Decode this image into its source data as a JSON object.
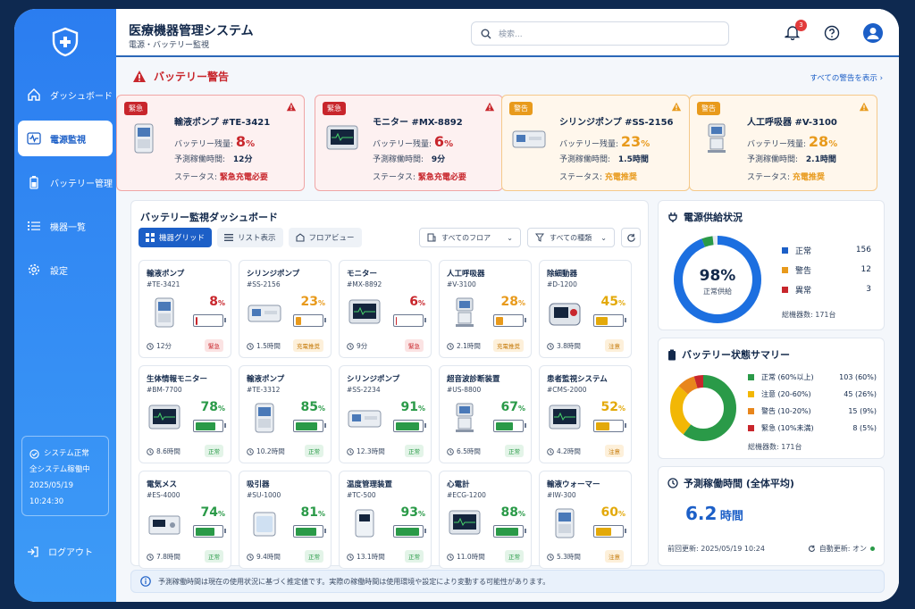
{
  "app": {
    "title": "医療機器管理システム",
    "subtitle": "電源・バッテリー監視"
  },
  "search": {
    "placeholder": "検索..."
  },
  "notifications": {
    "count": "3"
  },
  "sidebar": {
    "items": [
      {
        "label": "ダッシュボード",
        "icon": "home-icon"
      },
      {
        "label": "電源監視",
        "icon": "pulse-icon",
        "active": true
      },
      {
        "label": "バッテリー管理",
        "icon": "battery-icon"
      },
      {
        "label": "機器一覧",
        "icon": "list-icon"
      },
      {
        "label": "設定",
        "icon": "gear-icon"
      }
    ],
    "system": {
      "status": "システム正常",
      "detail": "全システム稼働中",
      "datetime": "2025/05/19 10:24:30"
    },
    "logout": "ログアウト"
  },
  "alerts": {
    "title": "バッテリー警告",
    "view_all": "すべての警告を表示",
    "labels": {
      "battery": "バッテリー残量:",
      "runtime": "予測稼働時間:",
      "status": "ステータス:"
    },
    "cards": [
      {
        "tag": "緊急",
        "name": "輸液ポンプ #TE-3421",
        "pct": "8",
        "unit": "%",
        "runtime": "12分",
        "status": "緊急充電必要",
        "level": "red"
      },
      {
        "tag": "緊急",
        "name": "モニター #MX-8892",
        "pct": "6",
        "unit": "%",
        "runtime": "9分",
        "status": "緊急充電必要",
        "level": "red"
      },
      {
        "tag": "警告",
        "name": "シリンジポンプ #SS-2156",
        "pct": "23",
        "unit": "%",
        "runtime": "1.5時間",
        "status": "充電推奨",
        "level": "org"
      },
      {
        "tag": "警告",
        "name": "人工呼吸器 #V-3100",
        "pct": "28",
        "unit": "%",
        "runtime": "2.1時間",
        "status": "充電推奨",
        "level": "org"
      }
    ]
  },
  "dashboard": {
    "title": "バッテリー監視ダッシュボード",
    "tabs": [
      "機器グリッド",
      "リスト表示",
      "フロアビュー"
    ],
    "filters": {
      "floor": "すべてのフロア",
      "type": "すべての種類"
    },
    "devices": [
      {
        "name": "輸液ポンプ",
        "id": "#TE-3421",
        "pct": 8,
        "time": "12分",
        "status": "緊急",
        "level": "red",
        "kind": "pump"
      },
      {
        "name": "シリンジポンプ",
        "id": "#SS-2156",
        "pct": 23,
        "time": "1.5時間",
        "status": "充電推奨",
        "level": "org",
        "kind": "syringe"
      },
      {
        "name": "モニター",
        "id": "#MX-8892",
        "pct": 6,
        "time": "9分",
        "status": "緊急",
        "level": "red",
        "kind": "monitor"
      },
      {
        "name": "人工呼吸器",
        "id": "#V-3100",
        "pct": 28,
        "time": "2.1時間",
        "status": "充電推奨",
        "level": "org",
        "kind": "vent"
      },
      {
        "name": "除細動器",
        "id": "#D-1200",
        "pct": 45,
        "time": "3.8時間",
        "status": "注意",
        "level": "yel",
        "kind": "defib"
      },
      {
        "name": "生体情報モニター",
        "id": "#BM-7700",
        "pct": 78,
        "time": "8.6時間",
        "status": "正常",
        "level": "grn",
        "kind": "monitor"
      },
      {
        "name": "輸液ポンプ",
        "id": "#TE-3312",
        "pct": 85,
        "time": "10.2時間",
        "status": "正常",
        "level": "grn",
        "kind": "pump"
      },
      {
        "name": "シリンジポンプ",
        "id": "#SS-2234",
        "pct": 91,
        "time": "12.3時間",
        "status": "正常",
        "level": "grn",
        "kind": "syringe"
      },
      {
        "name": "超音波診断装置",
        "id": "#US-8800",
        "pct": 67,
        "time": "6.5時間",
        "status": "正常",
        "level": "grn",
        "kind": "vent"
      },
      {
        "name": "患者監視システム",
        "id": "#CMS-2000",
        "pct": 52,
        "time": "4.2時間",
        "status": "注意",
        "level": "yel",
        "kind": "monitor"
      },
      {
        "name": "電気メス",
        "id": "#ES-4000",
        "pct": 74,
        "time": "7.8時間",
        "status": "正常",
        "level": "grn",
        "kind": "box"
      },
      {
        "name": "吸引器",
        "id": "#SU-1000",
        "pct": 81,
        "time": "9.4時間",
        "status": "正常",
        "level": "grn",
        "kind": "suction"
      },
      {
        "name": "温度管理装置",
        "id": "#TC-500",
        "pct": 93,
        "time": "13.1時間",
        "status": "正常",
        "level": "grn",
        "kind": "box2"
      },
      {
        "name": "心電計",
        "id": "#ECG-1200",
        "pct": 88,
        "time": "11.0時間",
        "status": "正常",
        "level": "grn",
        "kind": "monitor"
      },
      {
        "name": "輸液ウォーマー",
        "id": "#IW-300",
        "pct": 60,
        "time": "5.3時間",
        "status": "注意",
        "level": "yel",
        "kind": "pump"
      }
    ]
  },
  "power": {
    "title": "電源供給状況",
    "pct": "98%",
    "label": "正常供給",
    "items": [
      {
        "label": "正常",
        "value": "156"
      },
      {
        "label": "警告",
        "value": "12"
      },
      {
        "label": "異常",
        "value": "3"
      }
    ],
    "total": "総機器数: 171台",
    "fraction": 0.98
  },
  "summary": {
    "title": "バッテリー状態サマリー",
    "items": [
      {
        "label": "正常 (60%以上)",
        "value": "103 (60%)",
        "n": 103
      },
      {
        "label": "注意 (20-60%)",
        "value": "45 (26%)",
        "n": 45
      },
      {
        "label": "警告 (10-20%)",
        "value": "15 (9%)",
        "n": 15
      },
      {
        "label": "緊急 (10%未満)",
        "value": "8 (5%)",
        "n": 8
      }
    ],
    "total": "総機器数: 171台"
  },
  "runtime": {
    "title": "予測稼働時間 (全体平均)",
    "value": "6.2",
    "unit": "時間",
    "updated": "前回更新: 2025/05/19 10:24",
    "auto": "自動更新: オン"
  },
  "info": "予測稼働時間は現在の使用状況に基づく推定値です。実際の稼働時間は使用環境や設定により変動する可能性があります。",
  "colors": {
    "primary": "#1c5fc7",
    "red": "#c8262c",
    "orange": "#e89a1c",
    "yellow": "#f2b705",
    "green": "#2a9a48"
  }
}
